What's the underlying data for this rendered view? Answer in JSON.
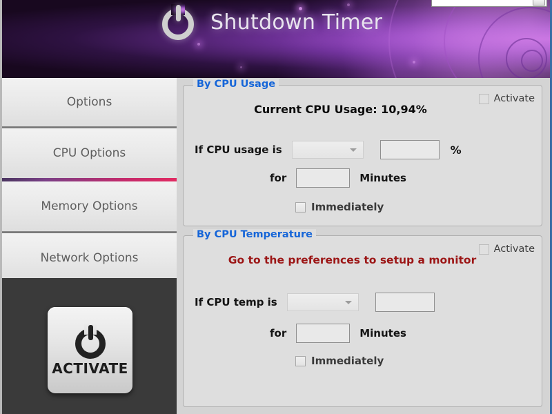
{
  "window": {
    "frame_color": "#3a6ea5",
    "body_background": "#d4d4d4"
  },
  "header": {
    "title": "Shutdown Timer",
    "power_icon": "power-icon",
    "background_colors": {
      "dark": "#18081f",
      "purple": "#6a2f93",
      "magenta": "#c066dd"
    }
  },
  "sidebar": {
    "items": [
      {
        "label": "Options",
        "active": false
      },
      {
        "label": "CPU Options",
        "active": true
      },
      {
        "label": "Memory Options",
        "active": false
      },
      {
        "label": "Network Options",
        "active": false
      }
    ],
    "active_indicator_color": "#e12a62",
    "activate_button": {
      "label": "ACTIVATE",
      "icon": "power-icon"
    }
  },
  "main": {
    "cpu_usage_panel": {
      "title": "By CPU Usage",
      "title_color": "#1565d8",
      "activate_checkbox": {
        "label": "Activate",
        "checked": false
      },
      "status_text": "Current CPU Usage: 10,94%",
      "condition_label": "If CPU usage is",
      "comparison_value": "",
      "comparison_placeholder": "",
      "threshold_value": "",
      "unit_label": "%",
      "duration_prefix": "for",
      "duration_value": "",
      "duration_unit": "Minutes",
      "immediately_checkbox": {
        "label": "Immediately",
        "checked": false
      }
    },
    "cpu_temp_panel": {
      "title": "By CPU Temperature",
      "title_color": "#1565d8",
      "activate_checkbox": {
        "label": "Activate",
        "checked": false
      },
      "warning_text": "Go to the preferences to setup a monitor",
      "warning_color": "#9c1616",
      "condition_label": "If CPU temp is",
      "comparison_value": "",
      "threshold_value": "",
      "duration_prefix": "for",
      "duration_value": "",
      "duration_unit": "Minutes",
      "immediately_checkbox": {
        "label": "Immediately",
        "checked": false
      }
    }
  }
}
